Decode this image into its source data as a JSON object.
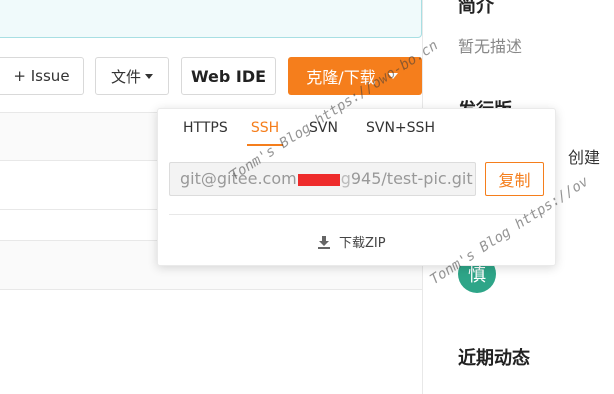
{
  "toolbar": {
    "issue_label": "+ Issue",
    "file_label": "文件",
    "webide_label": "Web IDE",
    "clone_label": "克隆/下载"
  },
  "clone_dropdown": {
    "tabs": [
      {
        "label": "HTTPS",
        "active": false
      },
      {
        "label": "SSH",
        "active": true
      },
      {
        "label": "SVN",
        "active": false
      },
      {
        "label": "SVN+SSH",
        "active": false
      }
    ],
    "url_prefix": "git@gitee.com",
    "url_hidden_fragment": "g",
    "url_suffix": "945/test-pic.git",
    "copy_label": "复制",
    "download_zip_label": "下载ZIP"
  },
  "sidebar": {
    "intro_heading": "简介",
    "intro_text": "暂无描述",
    "release_heading": "发行版",
    "create_link": "创建",
    "contributor_avatar": "慎",
    "activity_heading": "近期动态"
  },
  "watermarks": [
    "Tonm's Blog https://owo-bo.cn",
    "Tonm's Blog https://ov"
  ],
  "colors": {
    "accent": "#f57e1c",
    "redaction": "#ee2b2b",
    "avatar_bg": "#2ea588"
  }
}
